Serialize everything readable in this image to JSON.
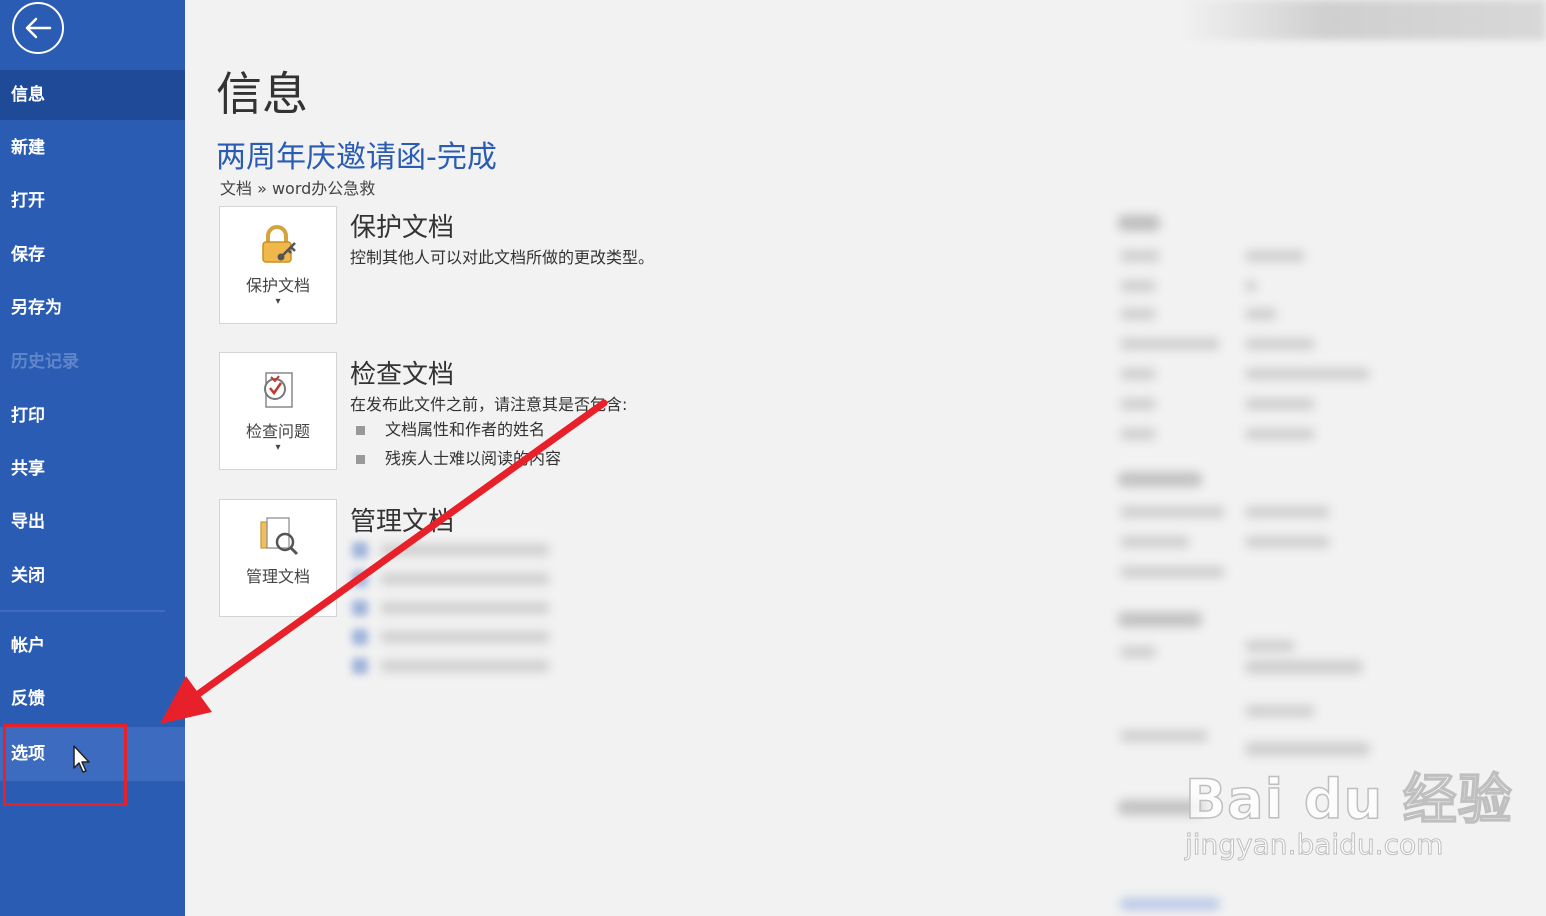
{
  "sidebar": {
    "items": [
      {
        "label": "信息"
      },
      {
        "label": "新建"
      },
      {
        "label": "打开"
      },
      {
        "label": "保存"
      },
      {
        "label": "另存为"
      },
      {
        "label": "历史记录"
      },
      {
        "label": "打印"
      },
      {
        "label": "共享"
      },
      {
        "label": "导出"
      },
      {
        "label": "关闭"
      },
      {
        "label": "帐户"
      },
      {
        "label": "反馈"
      },
      {
        "label": "选项"
      }
    ]
  },
  "main": {
    "title": "信息",
    "doc_title": "两周年庆邀请函-完成",
    "breadcrumb": "文档 » word办公急救",
    "protect": {
      "button_label": "保护文档",
      "title": "保护文档",
      "description": "控制其他人可以对此文档所做的更改类型。"
    },
    "inspect": {
      "button_label": "检查问题",
      "title": "检查文档",
      "description": "在发布此文件之前，请注意其是否包含:",
      "bullets": [
        "文档属性和作者的姓名",
        "残疾人士难以阅读的内容"
      ]
    },
    "manage": {
      "button_label": "管理文档",
      "title": "管理文档"
    }
  },
  "watermark": {
    "logo": "Bai du 经验",
    "url": "jingyan.baidu.com"
  },
  "colors": {
    "sidebar": "#2b5cb3",
    "accent": "#2b5cb3",
    "highlight": "#e8202a"
  }
}
